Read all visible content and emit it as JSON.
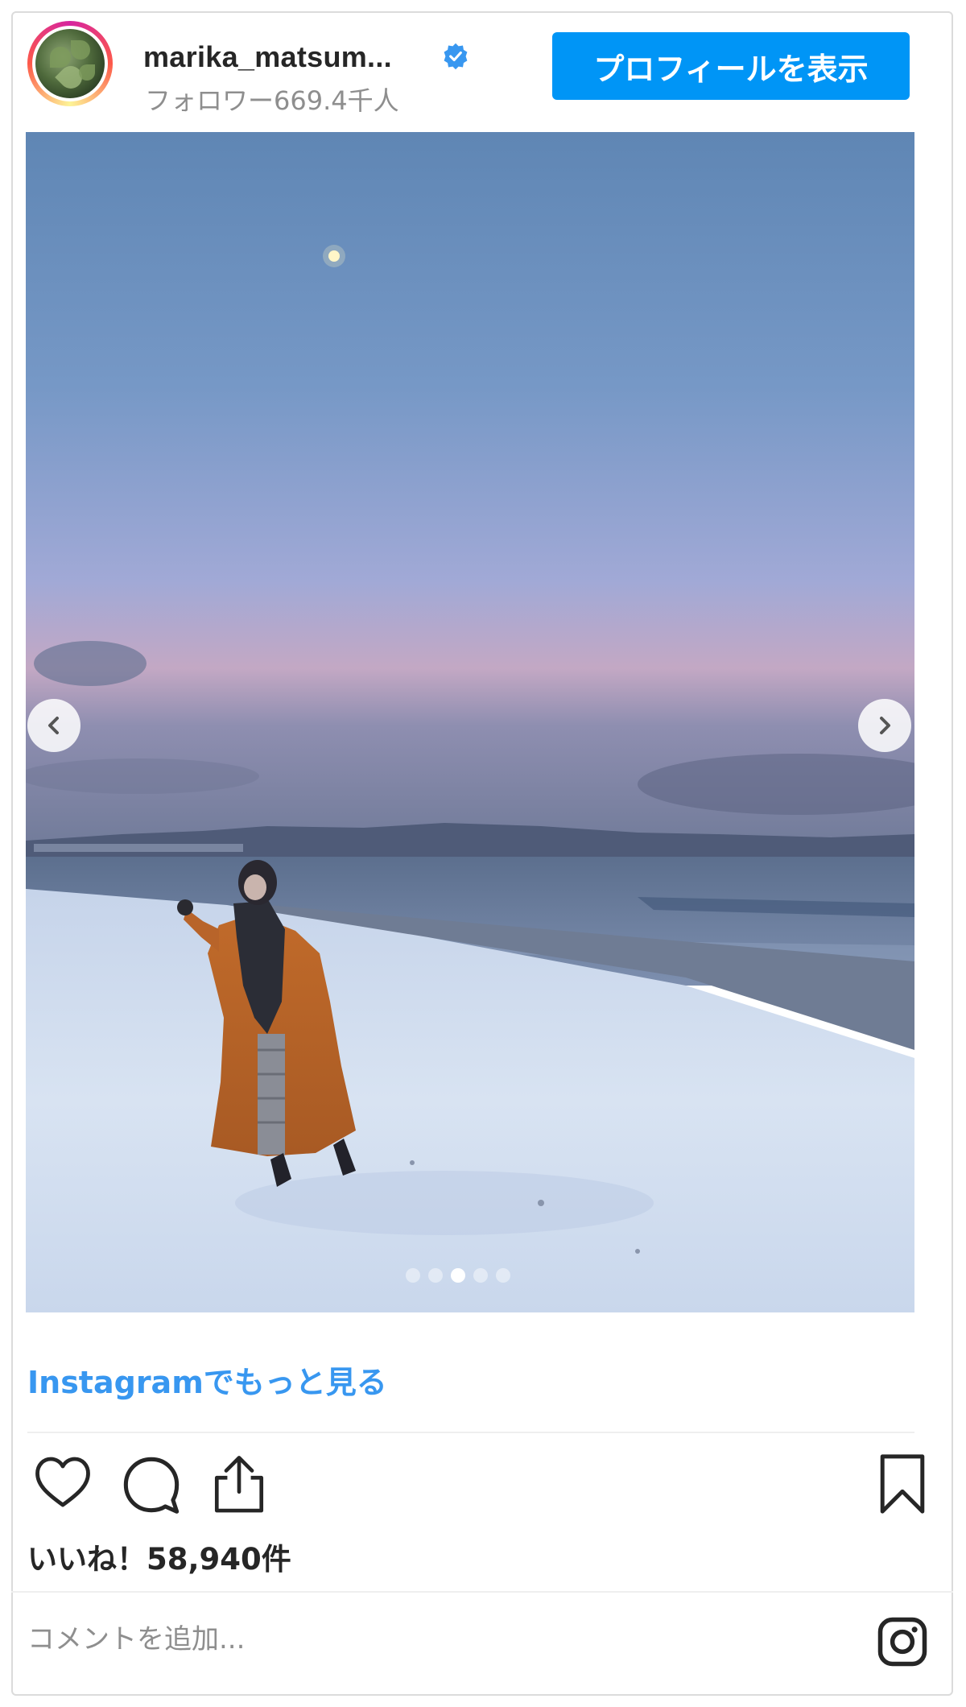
{
  "header": {
    "username": "marika_matsum...",
    "followers": "フォロワー669.4千人",
    "profile_button": "プロフィールを表示"
  },
  "carousel": {
    "total": 5,
    "active_index": 2
  },
  "links": {
    "more_on_instagram": "Instagramでもっと見る"
  },
  "actions": {
    "like_icon": "heart-icon",
    "comment_icon": "comment-icon",
    "share_icon": "share-icon",
    "save_icon": "bookmark-icon"
  },
  "likes_text": "いいね！58,940件",
  "comment": {
    "placeholder": "コメントを追加..."
  },
  "colors": {
    "accent": "#0095f6",
    "link": "#3897f0",
    "text": "#262626",
    "muted": "#8e8e8e"
  }
}
